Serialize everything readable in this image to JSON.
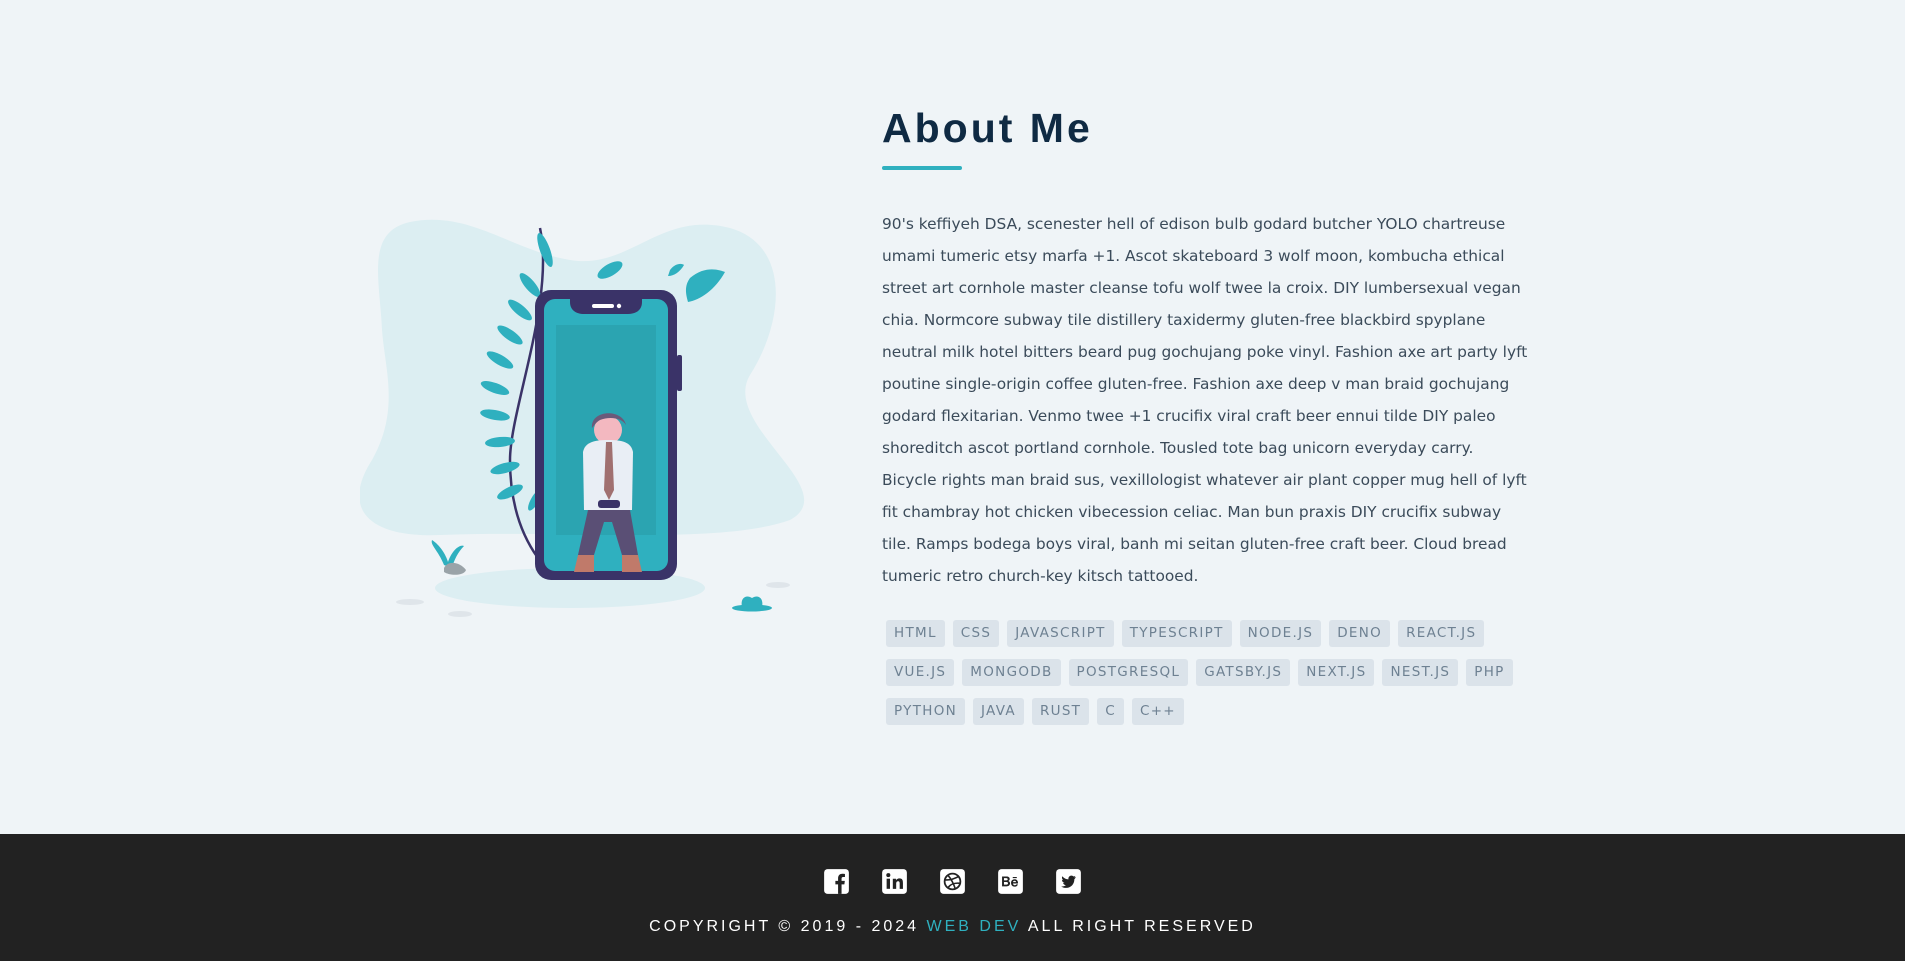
{
  "about": {
    "title": "About Me",
    "bio": "90's keffiyeh DSA, scenester hell of edison bulb godard butcher YOLO chartreuse umami tumeric etsy marfa +1. Ascot skateboard 3 wolf moon, kombucha ethical street art cornhole master cleanse tofu wolf twee la croix. DIY lumbersexual vegan chia. Normcore subway tile distillery taxidermy gluten-free blackbird spyplane neutral milk hotel bitters beard pug gochujang poke vinyl. Fashion axe art party lyft poutine single-origin coffee gluten-free. Fashion axe deep v man braid gochujang godard flexitarian. Venmo twee +1 crucifix viral craft beer ennui tilde DIY paleo shoreditch ascot portland cornhole. Tousled tote bag unicorn everyday carry. Bicycle rights man braid sus, vexillologist whatever air plant copper mug hell of lyft fit chambray hot chicken vibecession celiac. Man bun praxis DIY crucifix subway tile. Ramps bodega boys viral, banh mi seitan gluten-free craft beer. Cloud bread tumeric retro church-key kitsch tattooed.",
    "illustration_icon": "person-sitting-in-phone-illustration",
    "skills": [
      "HTML",
      "CSS",
      "JAVASCRIPT",
      "TYPESCRIPT",
      "NODE.JS",
      "DENO",
      "REACT.JS",
      "VUE.JS",
      "MONGODB",
      "POSTGRESQL",
      "GATSBY.JS",
      "NEXT.JS",
      "NEST.JS",
      "PHP",
      "PYTHON",
      "JAVA",
      "RUST",
      "C",
      "C++"
    ]
  },
  "footer": {
    "socials": [
      {
        "name": "facebook",
        "icon": "facebook-icon"
      },
      {
        "name": "linkedin",
        "icon": "linkedin-icon"
      },
      {
        "name": "dribbble",
        "icon": "dribbble-icon"
      },
      {
        "name": "behance",
        "icon": "behance-icon"
      },
      {
        "name": "twitter",
        "icon": "twitter-icon"
      }
    ],
    "copyright_prefix": "COPYRIGHT © 2019 - 2024",
    "brand": "WEB DEV",
    "copyright_suffix": "ALL RIGHT RESERVED"
  },
  "colors": {
    "background": "#eff4f7",
    "title": "#0f2a43",
    "accent": "#2fb0bf",
    "tag_bg": "#dbe3ea",
    "footer_bg": "#222222"
  }
}
